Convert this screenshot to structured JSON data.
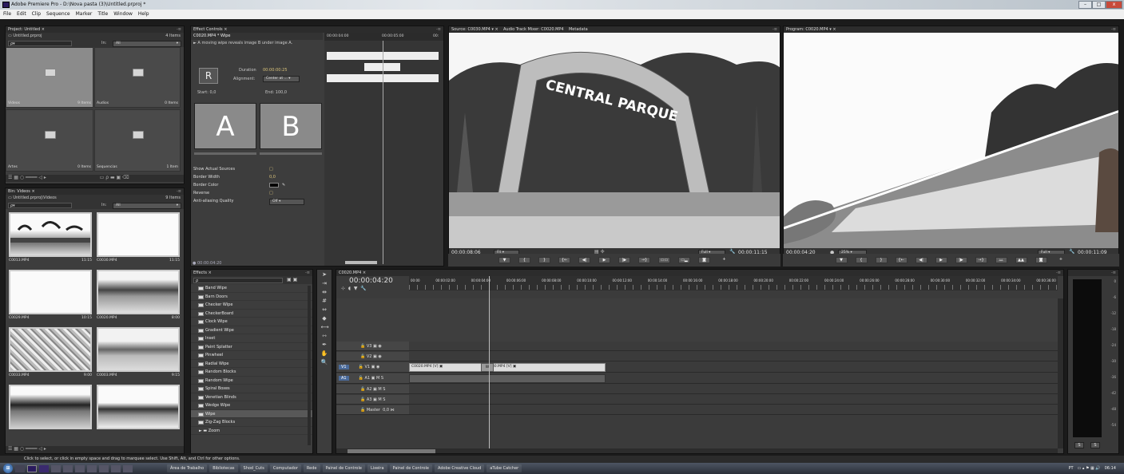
{
  "window": {
    "title": "Adobe Premiere Pro - D:\\Nova pasta (3)\\Untitled.prproj *",
    "min": "–",
    "max": "□",
    "close": "x"
  },
  "menu": [
    "File",
    "Edit",
    "Clip",
    "Sequence",
    "Marker",
    "Title",
    "Window",
    "Help"
  ],
  "project": {
    "tab": "Project: Untitled ×",
    "file": "Untitled.prproj",
    "count": "4 Items",
    "search": "ρ▾",
    "in_label": "In:",
    "in_value": "All",
    "bins": [
      {
        "name": "Videos",
        "count": "9 Items"
      },
      {
        "name": "Audios",
        "count": "0 Items"
      },
      {
        "name": "Artes",
        "count": "0 Items"
      },
      {
        "name": "Sequencias",
        "count": "1 Item"
      }
    ]
  },
  "bin_videos": {
    "tab": "Bin: Videos ×",
    "path": "Untitled.prproj\\Videos",
    "count": "9 Items",
    "search": "ρ▾",
    "in_label": "In:",
    "in_value": "All",
    "clips": [
      {
        "name": "C0013.MP4",
        "dur": "11:15"
      },
      {
        "name": "C0030.MP4",
        "dur": "11:15"
      },
      {
        "name": "C0029.MP4",
        "dur": "10:15"
      },
      {
        "name": "C0020.MP4",
        "dur": "8:00"
      },
      {
        "name": "C0033.MP4",
        "dur": "9:00"
      },
      {
        "name": "C0003.MP4",
        "dur": "9:15"
      }
    ]
  },
  "effect_controls": {
    "tab": "Effect Controls ×",
    "clip": "C0020.MP4 * Wipe",
    "desc": "► A moving wipe reveals image B under image A.",
    "duration_label": "Duration",
    "duration": "00:00:00:25",
    "alignment_label": "Alignment:",
    "alignment": "Center at ...",
    "start_label": "Start:",
    "start": "0,0",
    "end_label": "End:",
    "end": "100,0",
    "a": "A",
    "b": "B",
    "r": "R",
    "time_start": "00:00:04:00",
    "time_mid": "00:00:05:00",
    "time_end": "00:",
    "props": [
      {
        "name": "Show Actual Sources",
        "val": "□"
      },
      {
        "name": "Border Width",
        "val": "0,0"
      },
      {
        "name": "Border Color",
        "val": ""
      },
      {
        "name": "Reverse",
        "val": "□"
      },
      {
        "name": "Anti-aliasing Quality",
        "val": "Off"
      }
    ],
    "timecode": "● 00:00:04:20"
  },
  "effects": {
    "tab": "Effects ×",
    "search": "ρ",
    "items": [
      "Band Wipe",
      "Barn Doors",
      "Checker Wipe",
      "CheckerBoard",
      "Clock Wipe",
      "Gradient Wipe",
      "Inset",
      "Paint Splatter",
      "Pinwheel",
      "Radial Wipe",
      "Random Blocks",
      "Random Wipe",
      "Spiral Boxes",
      "Venetian Blinds",
      "Wedge Wipe",
      "Wipe",
      "Zig-Zag Blocks"
    ],
    "selected": "Wipe",
    "folder": "► ▬ Zoom"
  },
  "source": {
    "tabs": [
      "Source: C0030.MP4 ▾ ×",
      "Audio Track Mixer: C0020.MP4",
      "Metadata"
    ],
    "sign": "CENTRAL PARQUE",
    "tc_in": "00:00:08:06",
    "fit": "Fit",
    "res": "Full",
    "tc_dur": "00:00:11:15"
  },
  "program": {
    "tab": "Program: C0020.MP4 ▾ ×",
    "tc_in": "00:00:04:20",
    "zoom": "25%",
    "res": "Full",
    "tc_dur": "00:00:11:09"
  },
  "timeline": {
    "tab": "C0020.MP4 ×",
    "timecode": "00:00:04:20",
    "ruler": [
      "00:00",
      "00:00:02:00",
      "00:00:04:00",
      "00:00:06:00",
      "00:00:08:00",
      "00:00:10:00",
      "00:00:12:00",
      "00:00:14:00",
      "00:00:16:00",
      "00:00:18:00",
      "00:00:20:00",
      "00:00:22:00",
      "00:00:24:00",
      "00:00:26:00",
      "00:00:28:00",
      "00:00:30:00",
      "00:00:32:00",
      "00:00:34:00",
      "00:00:36:00"
    ],
    "tracks": [
      {
        "name": "V3",
        "src": ""
      },
      {
        "name": "V2",
        "src": ""
      },
      {
        "name": "V1",
        "src": "V1"
      },
      {
        "name": "A1",
        "src": "A1"
      },
      {
        "name": "A2",
        "src": ""
      },
      {
        "name": "A3",
        "src": ""
      },
      {
        "name": "Master",
        "src": ""
      }
    ],
    "master_vol": "0,0",
    "clips": [
      "C0020.MP4 [V] ▣",
      "C0030.MP4 [V] ▣"
    ],
    "transition": "W"
  },
  "meter": {
    "ticks": [
      "0",
      "-6",
      "-12",
      "-18",
      "-24",
      "-30",
      "-36",
      "-42",
      "-48",
      "-54"
    ],
    "solo": "S",
    "solo2": "S"
  },
  "status": "Click to select, or click in empty space and drag to marquee select. Use Shift, Alt, and Ctrl for other options.",
  "taskbar": {
    "start": "⊞",
    "items": [
      "Área de Trabalho",
      "Bibliotecas",
      "Shod_Cuts",
      "Computador",
      "Rede",
      "Painel de Controle",
      "Lixeira",
      "Painel de Controle",
      "Adobe Creative Cloud",
      "aTube Catcher"
    ],
    "lang": "PT",
    "clock": "06:14"
  }
}
